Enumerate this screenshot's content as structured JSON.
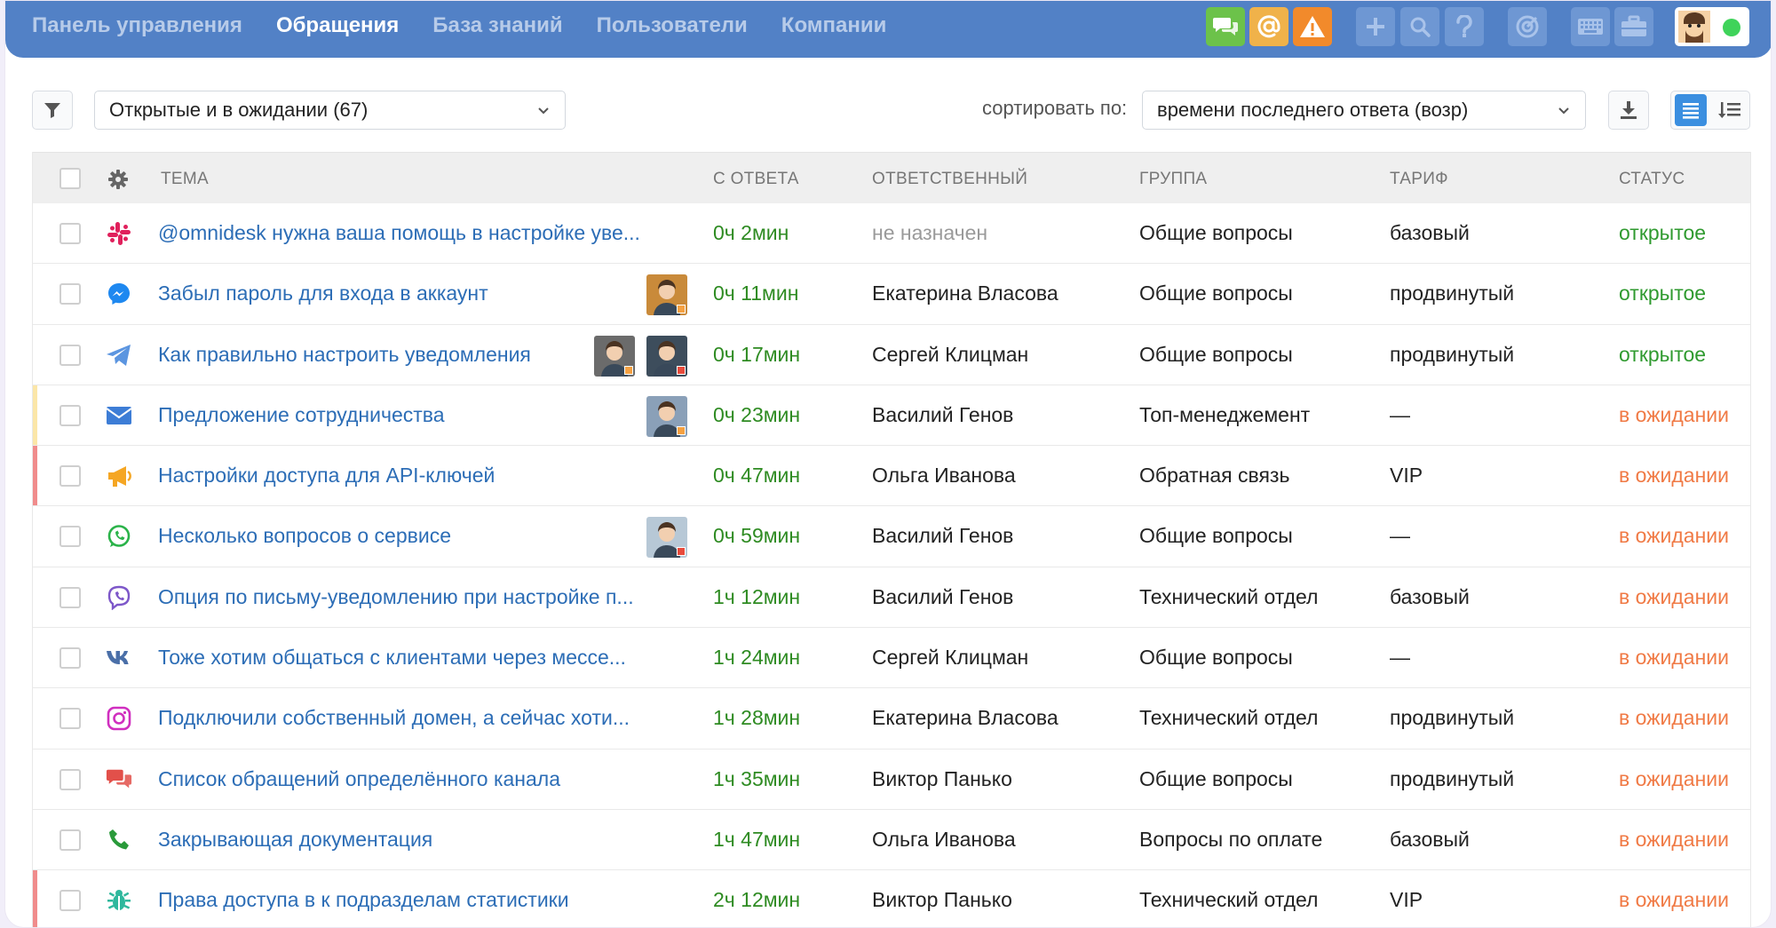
{
  "nav": {
    "items": [
      {
        "label": "Панель управления",
        "active": false
      },
      {
        "label": "Обращения",
        "active": true
      },
      {
        "label": "База знаний",
        "active": false
      },
      {
        "label": "Пользователи",
        "active": false
      },
      {
        "label": "Компании",
        "active": false
      }
    ],
    "toolbar_icons": [
      "chat-icon",
      "at-icon",
      "warning-icon",
      "plus-icon",
      "search-icon",
      "help-icon",
      "target-icon",
      "keyboard-icon",
      "briefcase-icon"
    ],
    "colors": {
      "bar": "#5281c6",
      "chat": "#6cc24a",
      "at": "#f0b24a",
      "warning": "#f28a2b",
      "muted_btn": "#6e97d3",
      "online": "#3fd35a"
    }
  },
  "toolbar": {
    "filter_value": "Открытые и в ожидании (67)",
    "sort_label": "сортировать по:",
    "sort_value": "времени последнего ответа (возр)"
  },
  "table": {
    "headers": {
      "subject": "ТЕМА",
      "since_reply": "С ОТВЕТА",
      "owner": "ОТВЕТСТВЕННЫЙ",
      "group": "ГРУППА",
      "tariff": "ТАРИФ",
      "status": "СТАТУС"
    },
    "rows": [
      {
        "channel": "slack-icon",
        "subject": "@omnidesk нужна ваша помощь в настройке уве...",
        "time": "0ч 2мин",
        "owner": "не назначен",
        "group": "Общие вопросы",
        "tariff": "базовый",
        "status": "открытое",
        "status_type": "open",
        "marker": null,
        "avatars": []
      },
      {
        "channel": "messenger-icon",
        "subject": "Забыл пароль для входа в аккаунт",
        "time": "0ч 11мин",
        "owner": "Екатерина Власова",
        "group": "Общие вопросы",
        "tariff": "продвинутый",
        "status": "открытое",
        "status_type": "open",
        "marker": null,
        "avatars": [
          {
            "bg": "#c98a3a",
            "dot": "#f5a142"
          }
        ]
      },
      {
        "channel": "telegram-icon",
        "subject": "Как правильно настроить уведомления",
        "time": "0ч 17мин",
        "owner": "Сергей Клицман",
        "group": "Общие вопросы",
        "tariff": "продвинутый",
        "status": "открытое",
        "status_type": "open",
        "marker": null,
        "avatars": [
          {
            "bg": "#6b6b6b",
            "dot": "#f5a142"
          },
          {
            "bg": "#3d4d5c",
            "dot": "#e84b3c"
          }
        ]
      },
      {
        "channel": "email-icon",
        "subject": "Предложение сотрудничества",
        "time": "0ч 23мин",
        "owner": "Василий Генов",
        "group": "Топ-менеджемент",
        "tariff": "—",
        "status": "в ожидании",
        "status_type": "wait",
        "marker": "#fbe6a8",
        "avatars": [
          {
            "bg": "#8aa0b8",
            "dot": "#f5a142"
          }
        ]
      },
      {
        "channel": "megaphone-icon",
        "subject": "Настройки доступа для API-ключей",
        "time": "0ч 47мин",
        "owner": "Ольга Иванова",
        "group": "Обратная связь",
        "tariff": "VIP",
        "status": "в ожидании",
        "status_type": "wait",
        "marker": "#f08c8c",
        "avatars": []
      },
      {
        "channel": "whatsapp-icon",
        "subject": "Несколько вопросов о сервисе",
        "time": "0ч 59мин",
        "owner": "Василий Генов",
        "group": "Общие вопросы",
        "tariff": "—",
        "status": "в ожидании",
        "status_type": "wait",
        "marker": null,
        "avatars": [
          {
            "bg": "#b7c8d6",
            "dot": "#e84b3c"
          }
        ]
      },
      {
        "channel": "viber-icon",
        "subject": "Опция по письму-уведомлению при настройке п...",
        "time": "1ч 12мин",
        "owner": "Василий Генов",
        "group": "Технический отдел",
        "tariff": "базовый",
        "status": "в ожидании",
        "status_type": "wait",
        "marker": null,
        "avatars": []
      },
      {
        "channel": "vk-icon",
        "subject": "Тоже хотим общаться с клиентами через мессе...",
        "time": "1ч 24мин",
        "owner": "Сергей Клицман",
        "group": "Общие вопросы",
        "tariff": "—",
        "status": "в ожидании",
        "status_type": "wait",
        "marker": null,
        "avatars": []
      },
      {
        "channel": "instagram-icon",
        "subject": "Подключили собственный домен, а сейчас хоти...",
        "time": "1ч 28мин",
        "owner": "Екатерина Власова",
        "group": "Технический отдел",
        "tariff": "продвинутый",
        "status": "в ожидании",
        "status_type": "wait",
        "marker": null,
        "avatars": []
      },
      {
        "channel": "chat-bubbles-icon",
        "subject": "Список обращений определённого канала",
        "time": "1ч 35мин",
        "owner": "Виктор Панько",
        "group": "Общие вопросы",
        "tariff": "продвинутый",
        "status": "в ожидании",
        "status_type": "wait",
        "marker": null,
        "avatars": []
      },
      {
        "channel": "phone-icon",
        "subject": "Закрывающая документация",
        "time": "1ч 47мин",
        "owner": "Ольга Иванова",
        "group": "Вопросы по оплате",
        "tariff": "базовый",
        "status": "в ожидании",
        "status_type": "wait",
        "marker": null,
        "avatars": []
      },
      {
        "channel": "bug-icon",
        "subject": "Права доступа в к подразделам статистики",
        "time": "2ч 12мин",
        "owner": "Виктор Панько",
        "group": "Технический отдел",
        "tariff": "VIP",
        "status": "в ожидании",
        "status_type": "wait",
        "marker": "#f08c8c",
        "avatars": []
      }
    ]
  }
}
